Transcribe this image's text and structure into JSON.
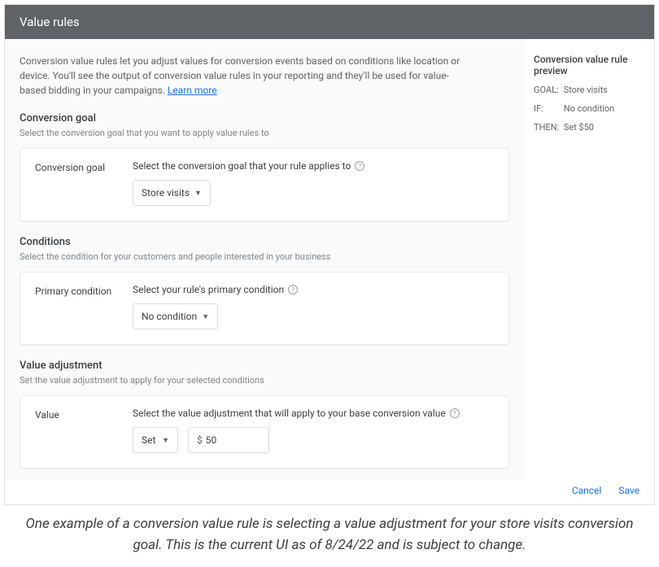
{
  "header": {
    "title": "Value rules"
  },
  "intro": {
    "text": "Conversion value rules let you adjust values for conversion events based on conditions like location or device. You'll see the output of conversion value rules in your reporting and they'll be used for value-based bidding in your campaigns. ",
    "link_text": "Learn more"
  },
  "goal_section": {
    "title": "Conversion goal",
    "sub": "Select the conversion goal that you want to apply value rules to",
    "row_label": "Conversion goal",
    "field_label": "Select the conversion goal that your rule applies to",
    "dropdown_value": "Store visits"
  },
  "conditions_section": {
    "title": "Conditions",
    "sub": "Select the condition for your customers and people interested in your business",
    "row_label": "Primary condition",
    "field_label": "Select your rule's primary condition",
    "dropdown_value": "No condition"
  },
  "value_section": {
    "title": "Value adjustment",
    "sub": "Set the value adjustment to apply for your selected conditions",
    "row_label": "Value",
    "field_label": "Select the value adjustment that will apply to your base conversion value",
    "op_value": "Set",
    "currency": "$",
    "amount": "50"
  },
  "preview": {
    "title": "Conversion value rule preview",
    "goal_label": "GOAL:",
    "goal_value": "Store visits",
    "if_label": "IF:",
    "if_value": "No condition",
    "then_label": "THEN:",
    "then_value": "Set $50"
  },
  "footer": {
    "cancel": "Cancel",
    "save": "Save"
  },
  "caption": "One example of a conversion value rule is selecting a value adjustment for your store visits conversion goal. This is the current UI as of 8/24/22 and is subject to change."
}
